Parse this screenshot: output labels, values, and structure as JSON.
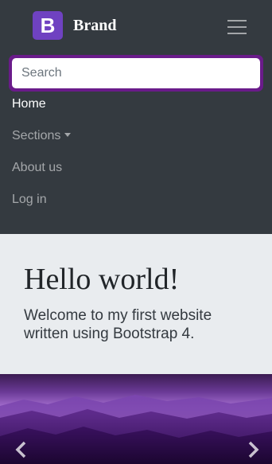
{
  "navbar": {
    "brand_logo_letter": "B",
    "brand_text": "Brand",
    "toggler_icon": "hamburger-menu-icon",
    "search": {
      "placeholder": "Search",
      "value": ""
    },
    "items": [
      {
        "label": "Home",
        "active": true
      },
      {
        "label": "Sections",
        "dropdown": true
      },
      {
        "label": "About us"
      },
      {
        "label": "Log in"
      }
    ]
  },
  "jumbotron": {
    "title": "Hello world!",
    "lead": "Welcome to my first website written using Bootstrap 4."
  },
  "carousel": {
    "image": "purple-mountain-landscape",
    "prev_icon": "chevron-left-icon",
    "next_icon": "chevron-right-icon"
  },
  "colors": {
    "navbar_bg": "#343a40",
    "brand_logo_bg": "#6f42c1",
    "search_focus_ring": "#6a1b8a",
    "jumbotron_bg": "#e9ecef"
  }
}
